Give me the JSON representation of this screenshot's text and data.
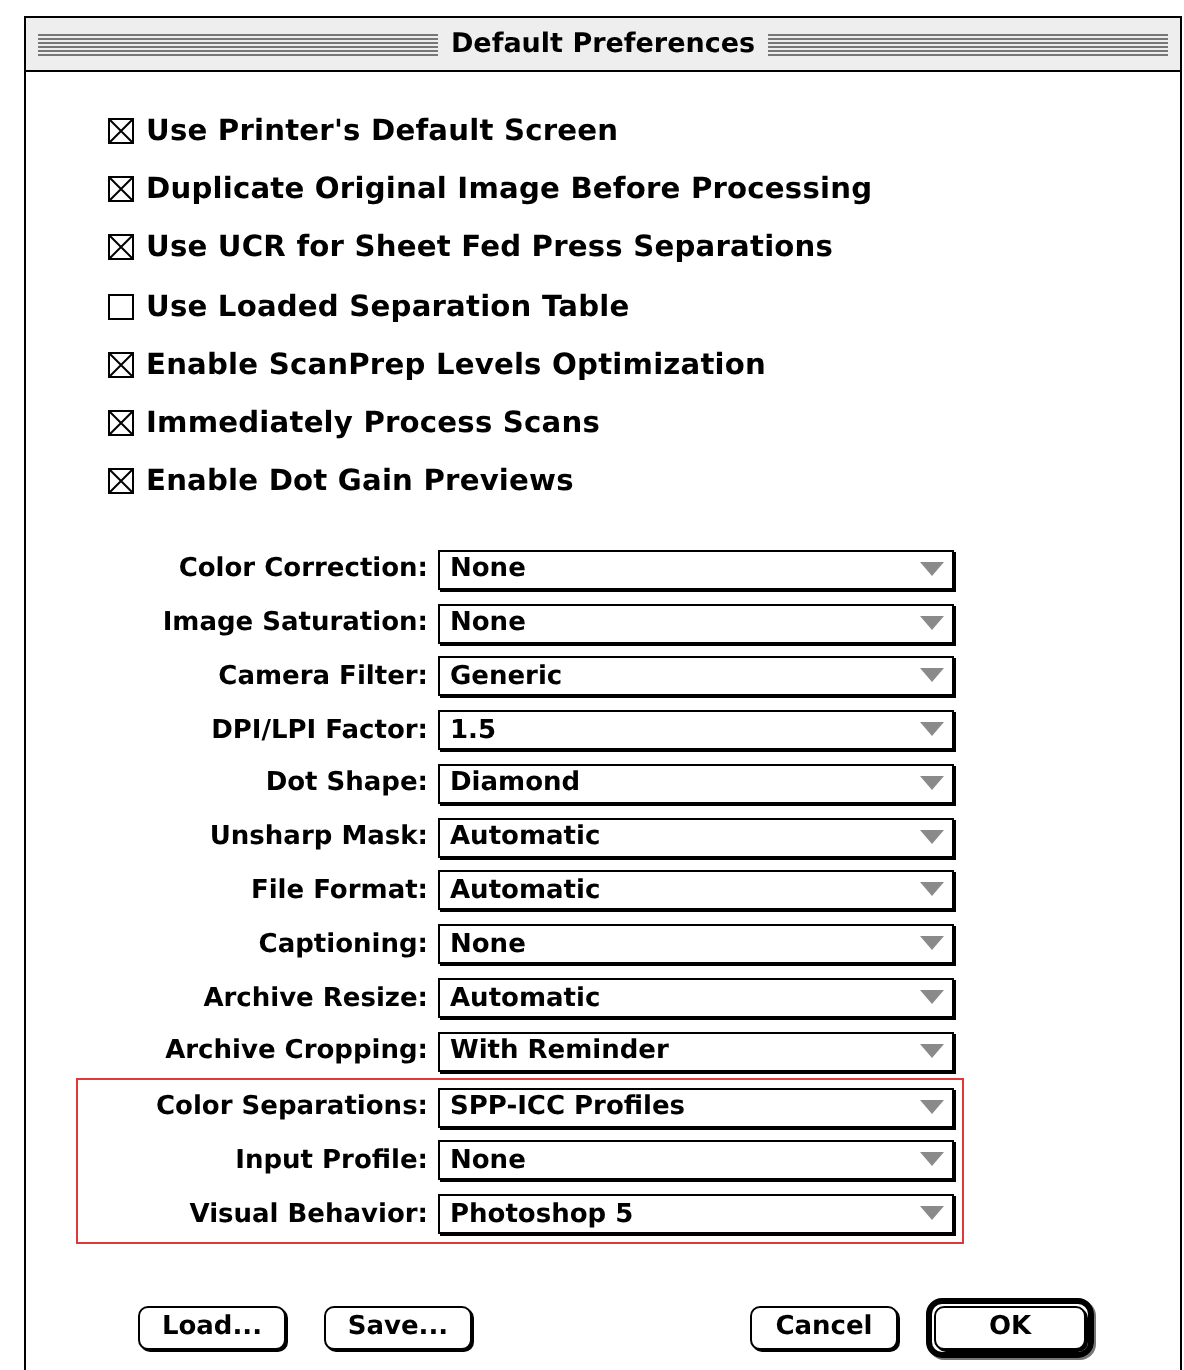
{
  "window": {
    "title": "Default Preferences"
  },
  "checkboxes": [
    {
      "label": "Use Printer's Default Screen",
      "checked": true
    },
    {
      "label": "Duplicate Original Image Before Processing",
      "checked": true
    },
    {
      "label": "Use UCR for Sheet Fed Press Separations",
      "checked": true
    },
    {
      "label": "Use Loaded Separation Table",
      "checked": false
    },
    {
      "label": "Enable ScanPrep Levels Optimization",
      "checked": true
    },
    {
      "label": "Immediately Process Scans",
      "checked": true
    },
    {
      "label": "Enable Dot Gain Previews",
      "checked": true
    }
  ],
  "popups": [
    {
      "label": "Color Correction:",
      "value": "None"
    },
    {
      "label": "Image Saturation:",
      "value": "None"
    },
    {
      "label": "Camera Filter:",
      "value": "Generic"
    },
    {
      "label": "DPI/LPI Factor:",
      "value": "1.5"
    },
    {
      "label": "Dot Shape:",
      "value": "Diamond"
    },
    {
      "label": "Unsharp Mask:",
      "value": "Automatic"
    },
    {
      "label": "File Format:",
      "value": "Automatic"
    },
    {
      "label": "Captioning:",
      "value": "None"
    },
    {
      "label": "Archive Resize:",
      "value": "Automatic"
    },
    {
      "label": "Archive Cropping:",
      "value": "With Reminder"
    }
  ],
  "highlighted_popups": [
    {
      "label": "Color Separations:",
      "value": "SPP-ICC Profiles"
    },
    {
      "label": "Input Profile:",
      "value": "None"
    },
    {
      "label": "Visual Behavior:",
      "value": "Photoshop 5"
    }
  ],
  "buttons": [
    {
      "label": "Load...",
      "default": false,
      "kind": "left"
    },
    {
      "label": "Save...",
      "default": false,
      "kind": "left"
    },
    {
      "label": "Cancel",
      "default": false,
      "kind": "right"
    },
    {
      "label": "OK",
      "default": true,
      "kind": "right"
    }
  ]
}
